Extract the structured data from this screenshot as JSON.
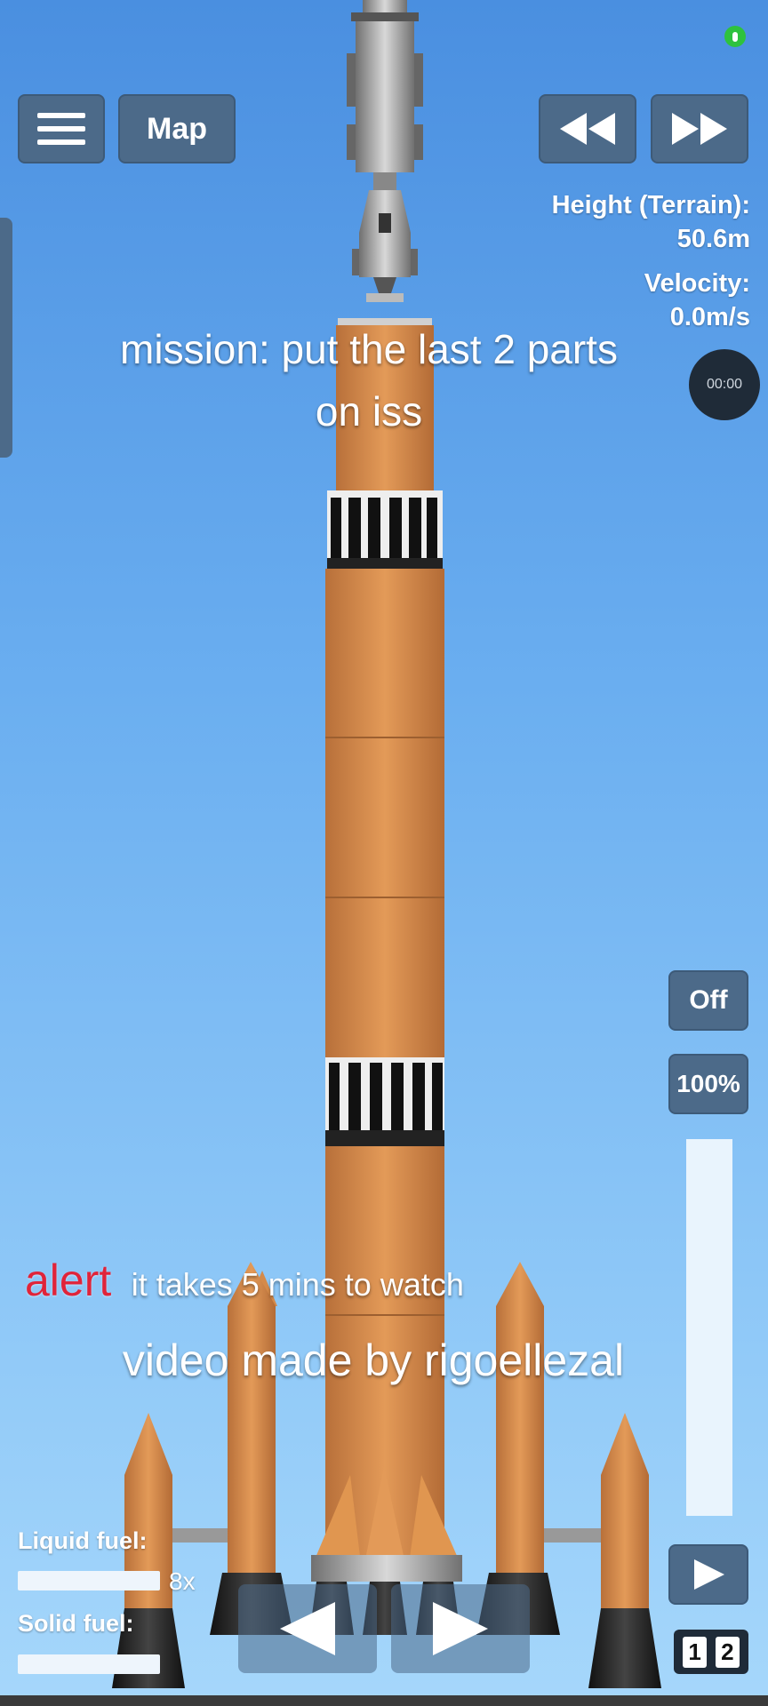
{
  "toolbar": {
    "menu_icon": "hamburger-menu-icon",
    "map_label": "Map",
    "rewind_icon": "rewind-icon",
    "fastforward_icon": "fast-forward-icon",
    "mic_icon": "microphone-indicator-icon"
  },
  "telemetry": {
    "height_label": "Height (Terrain):",
    "height_value": "50.6m",
    "velocity_label": "Velocity:",
    "velocity_value": "0.0m/s",
    "timer": "00:00"
  },
  "overlay": {
    "mission_line1": "mission: put the last 2 parts",
    "mission_line2": "on iss",
    "alert_word": "alert",
    "alert_text": "it takes 5 mins to watch",
    "credit": "video made by rigoellezal"
  },
  "controls": {
    "engine_toggle": "Off",
    "throttle_label": "100%",
    "throttle_level": 1.0,
    "play_icon": "play-icon",
    "stage_left_icon": "arrow-left-icon",
    "stage_right_icon": "arrow-right-icon",
    "stage_1": "1",
    "stage_2": "2"
  },
  "fuel": {
    "liquid_label": "Liquid fuel:",
    "solid_label": "Solid fuel:",
    "time_warp": "8x"
  },
  "colors": {
    "button_bg": "#4c6a89",
    "rocket_orange": "#d48a4a",
    "alert_red": "#e0243a"
  }
}
